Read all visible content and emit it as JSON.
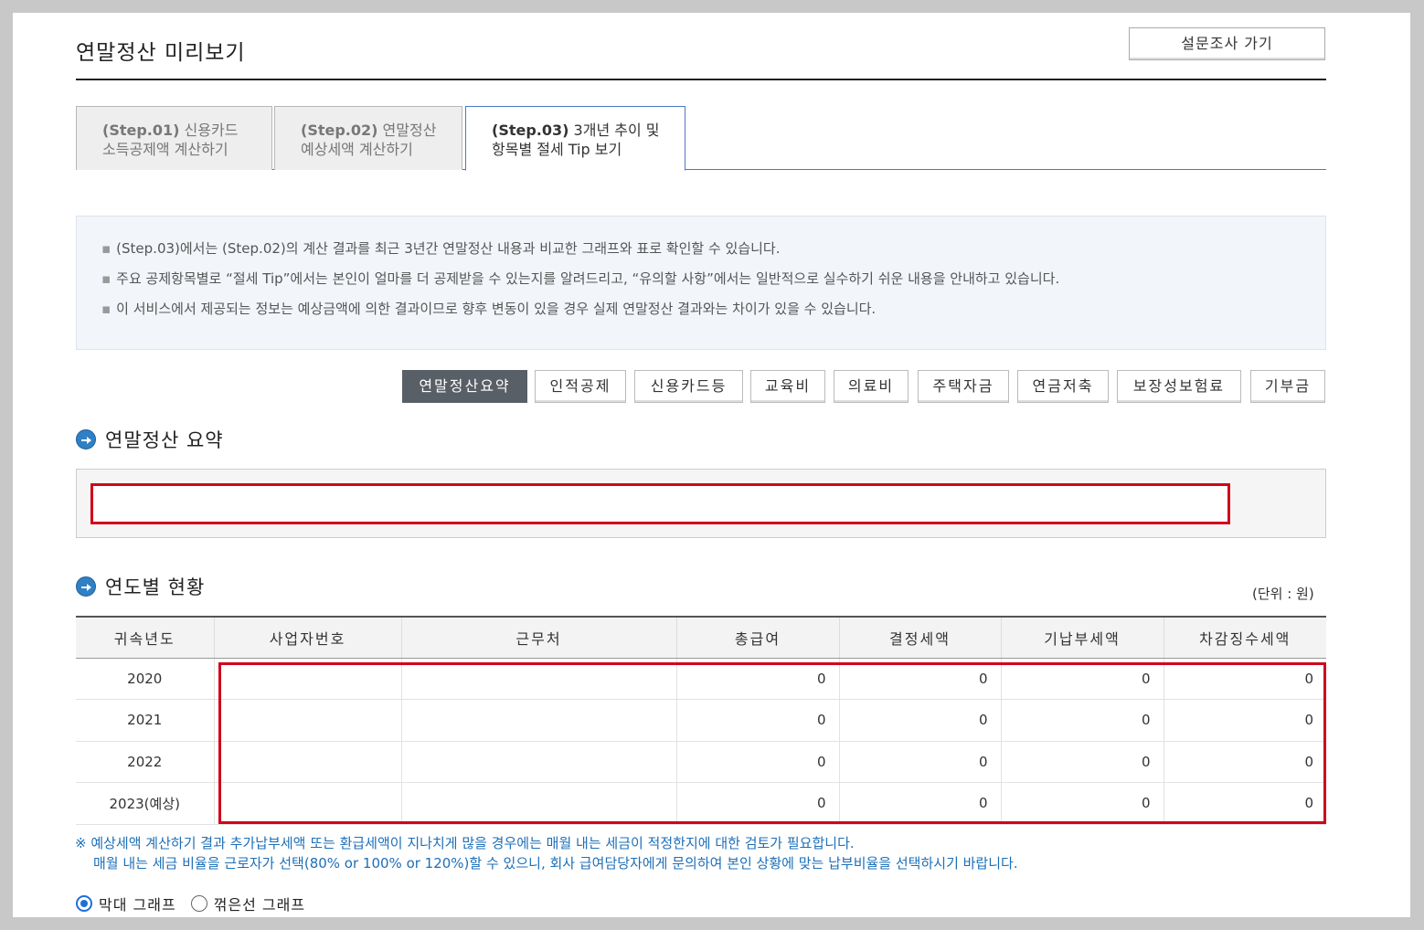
{
  "header": {
    "title": "연말정산 미리보기",
    "survey_button": "설문조사 가기"
  },
  "tabs": [
    {
      "step": "(Step.01)",
      "line1": "신용카드",
      "line2": "소득공제액 계산하기",
      "active": false
    },
    {
      "step": "(Step.02)",
      "line1": "연말정산",
      "line2": "예상세액 계산하기",
      "active": false
    },
    {
      "step": "(Step.03)",
      "line1": "3개년 추이 및",
      "line2": "항목별 절세 Tip 보기",
      "active": true
    }
  ],
  "info": [
    "(Step.03)에서는 (Step.02)의 계산 결과를 최근 3년간 연말정산 내용과 비교한 그래프와 표로 확인할 수 있습니다.",
    "주요 공제항목별로 “절세 Tip”에서는 본인이 얼마를 더 공제받을 수 있는지를 알려드리고, “유의할 사항”에서는 일반적으로 실수하기 쉬운 내용을 안내하고 있습니다.",
    "이 서비스에서 제공되는 정보는 예상금액에 의한 결과이므로 향후 변동이 있을 경우 실제 연말정산 결과와는 차이가 있을 수 있습니다."
  ],
  "category_buttons": [
    "연말정산요약",
    "인적공제",
    "신용카드등",
    "교육비",
    "의료비",
    "주택자금",
    "연금저축",
    "보장성보험료",
    "기부금"
  ],
  "active_category": "연말정산요약",
  "summary_section": {
    "title": "연말정산 요약",
    "content": ""
  },
  "yearly_section": {
    "title": "연도별 현황",
    "unit": "(단위 : 원)",
    "headers": [
      "귀속년도",
      "사업자번호",
      "근무처",
      "총급여",
      "결정세액",
      "기납부세액",
      "차감징수세액"
    ],
    "rows": [
      {
        "year": "2020",
        "bizno": "",
        "company": "",
        "salary": "0",
        "decided": "0",
        "prepaid": "0",
        "diff": "0"
      },
      {
        "year": "2021",
        "bizno": "",
        "company": "",
        "salary": "0",
        "decided": "0",
        "prepaid": "0",
        "diff": "0"
      },
      {
        "year": "2022",
        "bizno": "",
        "company": "",
        "salary": "0",
        "decided": "0",
        "prepaid": "0",
        "diff": "0"
      },
      {
        "year": "2023(예상)",
        "bizno": "",
        "company": "",
        "salary": "0",
        "decided": "0",
        "prepaid": "0",
        "diff": "0"
      }
    ]
  },
  "note": {
    "line1": "※ 예상세액 계산하기 결과 추가납부세액 또는 환급세액이 지나치게 많을 경우에는 매월 내는 세금이 적정한지에 대한 검토가 필요합니다.",
    "line2": "매월 내는 세금 비율을 근로자가 선택(80% or 100% or 120%)할 수 있으니, 회사 급여담당자에게 문의하여 본인 상황에 맞는 납부비율을 선택하시기 바랍니다."
  },
  "graph_options": {
    "bar_label": "막대 그래프",
    "line_label": "꺾은선 그래프",
    "selected": "막대 그래프"
  },
  "colors": {
    "accent": "#2f80c4",
    "active_button": "#595f66",
    "highlight_box": "#d0021b",
    "note_text": "#1d6fb8"
  }
}
